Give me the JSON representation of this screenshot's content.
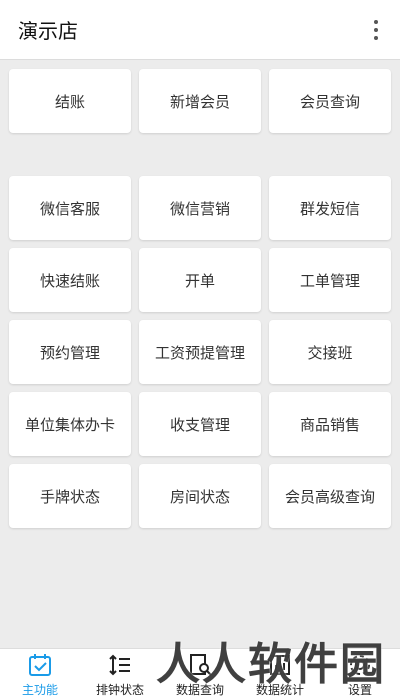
{
  "appbar": {
    "title": "演示店",
    "menu_icon": "more-vert-icon"
  },
  "menu_group_1": [
    {
      "label": "结账"
    },
    {
      "label": "新增会员"
    },
    {
      "label": "会员查询"
    }
  ],
  "menu_group_2": [
    {
      "label": "微信客服"
    },
    {
      "label": "微信营销"
    },
    {
      "label": "群发短信"
    },
    {
      "label": "快速结账"
    },
    {
      "label": "开单"
    },
    {
      "label": "工单管理"
    },
    {
      "label": "预约管理"
    },
    {
      "label": "工资预提管理"
    },
    {
      "label": "交接班"
    },
    {
      "label": "单位集体办卡"
    },
    {
      "label": "收支管理"
    },
    {
      "label": "商品销售"
    },
    {
      "label": "手牌状态"
    },
    {
      "label": "房间状态"
    },
    {
      "label": "会员高级查询"
    }
  ],
  "tabbar": {
    "active_color": "#1a9be8",
    "tabs": [
      {
        "label": "主功能",
        "icon": "calendar-check-icon",
        "active": true
      },
      {
        "label": "排钟状态",
        "icon": "sort-list-icon",
        "active": false
      },
      {
        "label": "数据查询",
        "icon": "document-search-icon",
        "active": false
      },
      {
        "label": "数据统计",
        "icon": "chart-icon",
        "active": false
      },
      {
        "label": "设置",
        "icon": "settings-icon",
        "active": false
      }
    ]
  },
  "watermark": {
    "text": "人人软件园"
  }
}
